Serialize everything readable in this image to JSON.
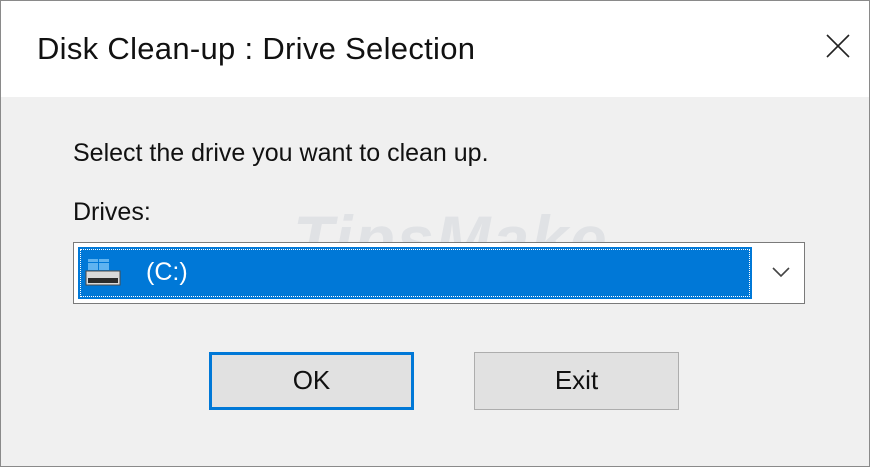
{
  "window": {
    "title": "Disk Clean-up : Drive Selection"
  },
  "dialog": {
    "prompt": "Select the drive you want to clean up.",
    "drives_label": "Drives:",
    "selected_drive": "(C:)",
    "ok_label": "OK",
    "exit_label": "Exit"
  },
  "watermark": "TipsMake",
  "icons": {
    "close": "close-icon",
    "drive": "hard-drive-icon",
    "dropdown": "chevron-down-icon"
  },
  "colors": {
    "selection": "#0078d7",
    "button_face": "#e1e1e1",
    "default_button_border": "#0078d7"
  }
}
